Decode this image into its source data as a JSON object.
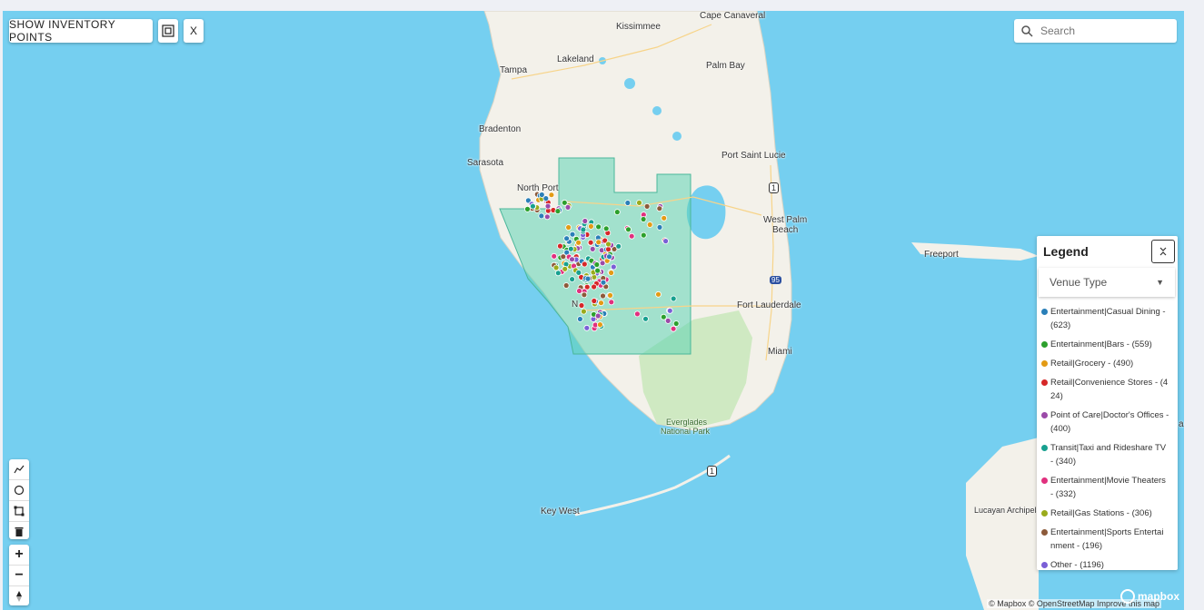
{
  "toolbar": {
    "show_inventory_label": "SHOW INVENTORY POINTS",
    "select_area_icon": "select-area-icon",
    "close_label": "X"
  },
  "search": {
    "placeholder": "Search",
    "icon": "search-icon"
  },
  "map_labels": {
    "cape_canaveral": "Cape Canaveral",
    "kissimmee": "Kissimmee",
    "tampa": "Tampa",
    "lakeland": "Lakeland",
    "palm_bay": "Palm Bay",
    "bradenton": "Bradenton",
    "sarasota": "Sarasota",
    "port_saint_lucie": "Port Saint Lucie",
    "north_port": "North Port",
    "west_palm_beach_1": "West Palm",
    "west_palm_beach_2": "Beach",
    "freeport": "Freeport",
    "fort_lauderdale": "Fort Lauderdale",
    "miami": "Miami",
    "everglades_1": "Everglades",
    "everglades_2": "National Park",
    "key_west": "Key West",
    "lucayan": "Lucayan Archipela",
    "naples_fragment": "N",
    "edge_fragment": "a",
    "shield_1": "1",
    "shield_95": "95"
  },
  "legend": {
    "title": "Legend",
    "collapse_icon": "collapse-icon",
    "dropdown_label": "Venue Type",
    "items": [
      {
        "line1": "Entertainment|Casual Dining -",
        "line2": "(623)",
        "color": "#2a7fb8"
      },
      {
        "line1": "Entertainment|Bars - (559)",
        "line2": "",
        "color": "#2ca02c"
      },
      {
        "line1": "Retail|Grocery - (490)",
        "line2": "",
        "color": "#e39b15"
      },
      {
        "line1": "Retail|Convenience Stores - (4",
        "line2": "24)",
        "color": "#d62728"
      },
      {
        "line1": "Point of Care|Doctor's Offices -",
        "line2": "(400)",
        "color": "#9b4aa8"
      },
      {
        "line1": "Transit|Taxi and Rideshare TV",
        "line2": "- (340)",
        "color": "#17a08f"
      },
      {
        "line1": "Entertainment|Movie Theaters",
        "line2": "- (332)",
        "color": "#e0307e"
      },
      {
        "line1": "Retail|Gas Stations - (306)",
        "line2": "",
        "color": "#9aab1c"
      },
      {
        "line1": "Entertainment|Sports Entertai",
        "line2": "nment - (196)",
        "color": "#8c5a3a"
      },
      {
        "line1": "Other - (1196)",
        "line2": "",
        "color": "#7a5fd6"
      }
    ]
  },
  "draw_tools": [
    "line-draw-icon",
    "circle-draw-icon",
    "polygon-draw-icon",
    "trash-icon"
  ],
  "zoom": {
    "in": "+",
    "out": "−",
    "compass": "compass-icon"
  },
  "attribution": "© Mapbox © OpenStreetMap  Improve this map",
  "mapbox_logo": "mapbox"
}
